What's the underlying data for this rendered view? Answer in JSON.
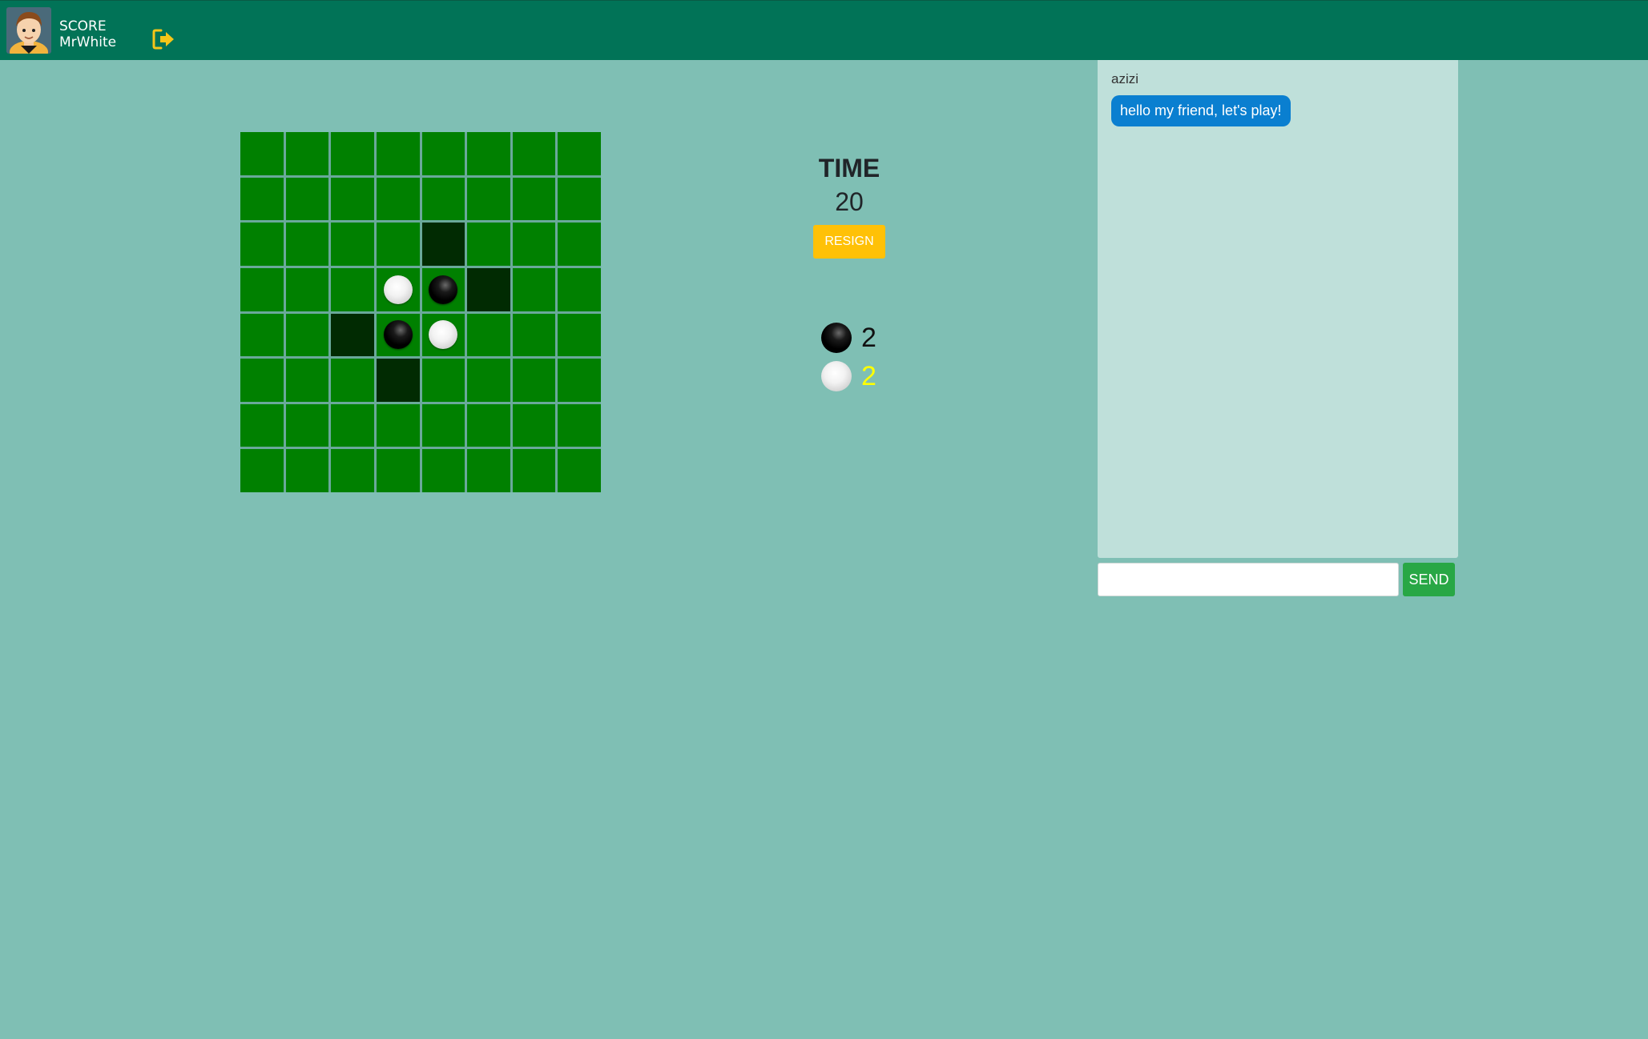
{
  "header": {
    "score_label": "SCORE",
    "username": "MrWhite",
    "avatar_icon": "user-avatar",
    "logout_icon": "sign-out-icon"
  },
  "board": {
    "size": 8,
    "cell_color": "#008000",
    "hint_color": "#012b02",
    "cells": [
      [
        "",
        "",
        "",
        "",
        "",
        "",
        "",
        ""
      ],
      [
        "",
        "",
        "",
        "",
        "",
        "",
        "",
        ""
      ],
      [
        "",
        "",
        "",
        "",
        "hint",
        "",
        "",
        ""
      ],
      [
        "",
        "",
        "",
        "white",
        "black",
        "hint",
        "",
        ""
      ],
      [
        "",
        "",
        "hint",
        "black",
        "white",
        "",
        "",
        ""
      ],
      [
        "",
        "",
        "",
        "hint",
        "",
        "",
        "",
        ""
      ],
      [
        "",
        "",
        "",
        "",
        "",
        "",
        "",
        ""
      ],
      [
        "",
        "",
        "",
        "",
        "",
        "",
        "",
        ""
      ]
    ]
  },
  "game": {
    "time_label": "TIME",
    "time_value": "20",
    "resign_label": "RESIGN",
    "black_score": "2",
    "white_score": "2",
    "black_score_color": "#111111",
    "white_score_color": "#ffff00"
  },
  "chat": {
    "messages": [
      {
        "sender": "azizi",
        "text": "hello my friend, let's play!"
      }
    ],
    "input_value": "",
    "send_label": "SEND"
  }
}
